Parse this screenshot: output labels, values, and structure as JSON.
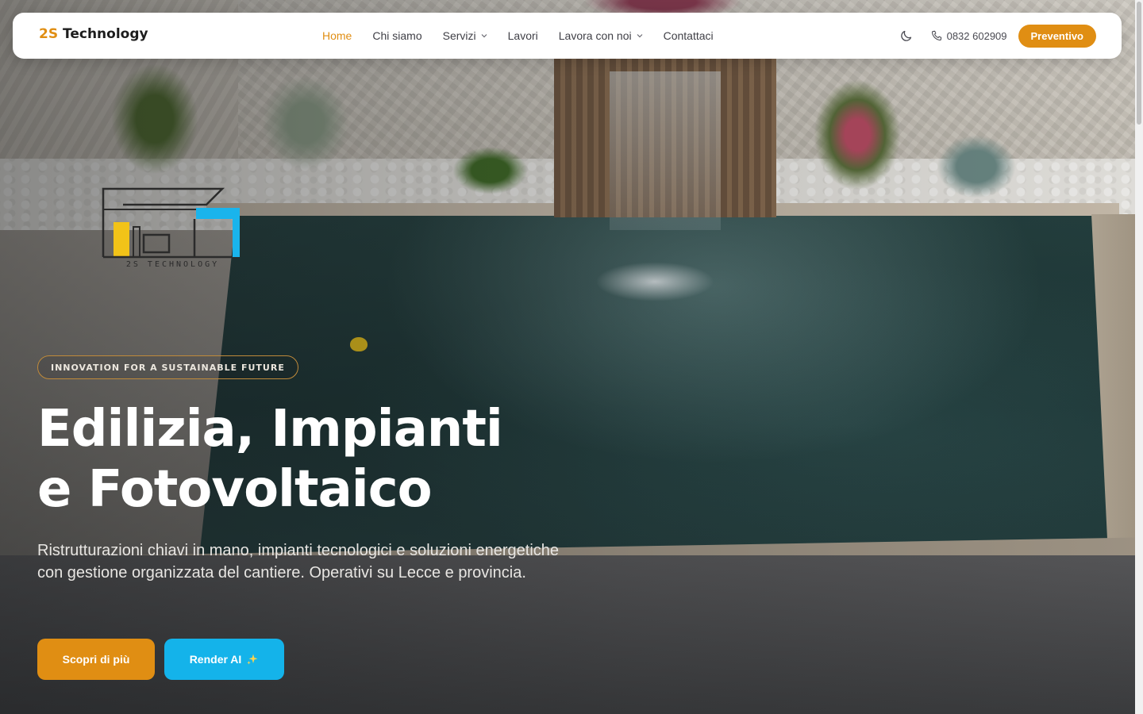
{
  "brand": {
    "prefix": "2S",
    "name": " Technology"
  },
  "nav": {
    "items": [
      {
        "label": "Home",
        "active": true,
        "has_dropdown": false
      },
      {
        "label": "Chi siamo",
        "active": false,
        "has_dropdown": false
      },
      {
        "label": "Servizi",
        "active": false,
        "has_dropdown": true
      },
      {
        "label": "Lavori",
        "active": false,
        "has_dropdown": false
      },
      {
        "label": "Lavora con noi",
        "active": false,
        "has_dropdown": true
      },
      {
        "label": "Contattaci",
        "active": false,
        "has_dropdown": false
      }
    ],
    "theme_toggle_icon": "moon-icon",
    "phone_icon": "phone-icon",
    "phone": "0832 602909",
    "cta_label": "Preventivo"
  },
  "logo_graphic": {
    "wordmark": "2S TECHNOLOGY"
  },
  "hero": {
    "tagline": "INNOVATION FOR A SUSTAINABLE FUTURE",
    "headline_line1": "Edilizia, Impianti",
    "headline_line2": "e Fotovoltaico",
    "subtitle": "Ristrutturazioni chiavi in mano, impianti tecnologici e soluzioni energetiche con gestione organizzata del cantiere. Operativi su Lecce e provincia.",
    "primary_cta": "Scopri di più",
    "secondary_cta": "Render AI",
    "secondary_cta_icon": "sparkles-icon"
  },
  "colors": {
    "accent": "#e08e13",
    "secondary": "#14b3ea",
    "logo_yellow": "#f2c318",
    "logo_blue": "#1ab4ec"
  }
}
